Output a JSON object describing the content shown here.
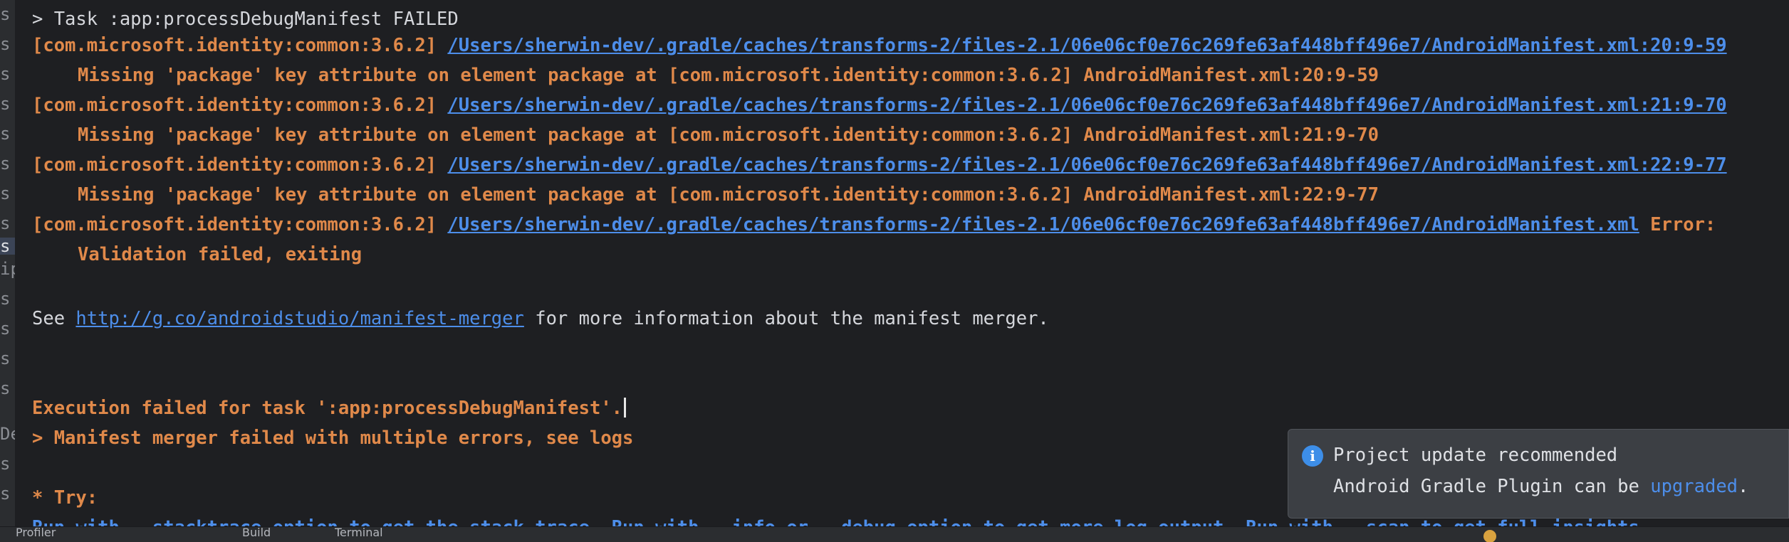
{
  "gutter": {
    "chars": [
      "s",
      "s",
      "s",
      "s",
      "s",
      "s",
      "s",
      "s",
      "s",
      "ip",
      "s",
      "s",
      "s",
      "s",
      "De",
      "s",
      "s"
    ],
    "selected_index": 8
  },
  "console": {
    "task_line": "> Task :app:processDebugManifest FAILED",
    "entries": [
      {
        "source": "[com.microsoft.identity:common:3.6.2]",
        "path": "/Users/sherwin-dev/.gradle/caches/transforms-2/files-2.1/06e06cf0e76c269fe63af448bff496e7/AndroidManifest.xml:20:9-59",
        "suffix": "",
        "message": "Missing 'package' key attribute on element package at [com.microsoft.identity:common:3.6.2] AndroidManifest.xml:20:9-59"
      },
      {
        "source": "[com.microsoft.identity:common:3.6.2]",
        "path": "/Users/sherwin-dev/.gradle/caches/transforms-2/files-2.1/06e06cf0e76c269fe63af448bff496e7/AndroidManifest.xml:21:9-70",
        "suffix": "",
        "message": "Missing 'package' key attribute on element package at [com.microsoft.identity:common:3.6.2] AndroidManifest.xml:21:9-70"
      },
      {
        "source": "[com.microsoft.identity:common:3.6.2]",
        "path": "/Users/sherwin-dev/.gradle/caches/transforms-2/files-2.1/06e06cf0e76c269fe63af448bff496e7/AndroidManifest.xml:22:9-77",
        "suffix": "",
        "message": "Missing 'package' key attribute on element package at [com.microsoft.identity:common:3.6.2] AndroidManifest.xml:22:9-77"
      },
      {
        "source": "[com.microsoft.identity:common:3.6.2]",
        "path": "/Users/sherwin-dev/.gradle/caches/transforms-2/files-2.1/06e06cf0e76c269fe63af448bff496e7/AndroidManifest.xml",
        "suffix": " Error:",
        "message": "Validation failed, exiting"
      }
    ],
    "see_prefix": "See ",
    "see_link": "http://g.co/androidstudio/manifest-merger",
    "see_suffix": " for more information about the manifest merger.",
    "execution_failed": "Execution failed for task ':app:processDebugManifest'.",
    "merger_failed": "> Manifest merger failed with multiple errors, see logs",
    "try_label": "* Try:",
    "run_line": {
      "run1": "Run with --stacktrace option to get the stack trace.",
      "run2": "Run with --info or --debug option to get more log output.",
      "run3": "Run with --scan to get full insights."
    }
  },
  "notification": {
    "icon": "info-icon",
    "title": "Project update recommended",
    "body_prefix": "Android Gradle Plugin can be ",
    "body_link": "upgraded",
    "body_suffix": "."
  },
  "statusbar": {
    "items": [
      "Profiler",
      "Build",
      "Terminal"
    ]
  }
}
